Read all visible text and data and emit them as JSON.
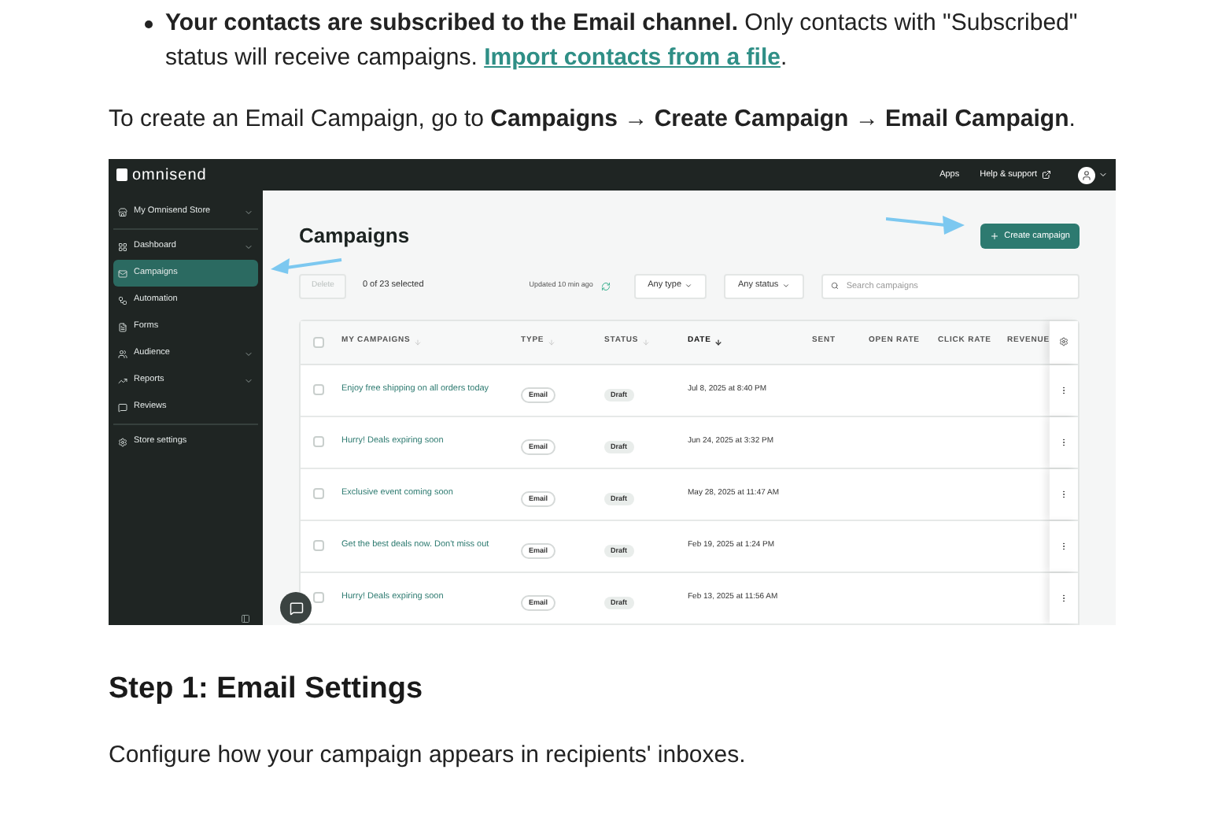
{
  "bullet": {
    "text": "**Your contacts are subscribed to the Email channel.** Only contacts with \"Subscribed\" status will receive campaigns.",
    "link": "Import contacts from a file",
    "after": "."
  },
  "intro": "To create an Email Campaign, go to **Campaigns → Create Campaign → Email Campaign**.",
  "screenshot": {
    "app_bar": {
      "logo": "omnisend",
      "links": [
        "Apps",
        "Help & support"
      ]
    },
    "sidebar": {
      "items": [
        {
          "label": "My Omnisend Store",
          "selected": false,
          "expandable": true
        },
        {
          "label": "Dashboard",
          "selected": false,
          "expandable": true
        },
        {
          "label": "Campaigns",
          "selected": true,
          "expandable": false
        },
        {
          "label": "Automation",
          "selected": false,
          "expandable": false
        },
        {
          "label": "Forms",
          "selected": false,
          "expandable": false
        },
        {
          "label": "Audience",
          "selected": false,
          "expandable": true
        },
        {
          "label": "Reports",
          "selected": false,
          "expandable": true
        },
        {
          "label": "Reviews",
          "selected": false,
          "expandable": false
        },
        {
          "label": "Store settings",
          "selected": false,
          "expandable": false
        }
      ]
    },
    "title": "Campaigns",
    "create_button": "Create campaign",
    "toolbar": {
      "delete_button": "Delete",
      "selection": "0 of 23 selected",
      "updated": "Updated 10 min ago",
      "type_filter": "Any type",
      "status_filter": "Any status",
      "search": {
        "placeholder": "Search campaigns"
      }
    },
    "table": {
      "select_all": {
        "checked": false
      },
      "columns": [
        {
          "label": "MY CAMPAIGNS",
          "sortable": true,
          "sorted": false
        },
        {
          "label": "TYPE",
          "sortable": true,
          "sorted": false
        },
        {
          "label": "STATUS",
          "sortable": true,
          "sorted": false
        },
        {
          "label": "DATE",
          "sortable": true,
          "sorted": true
        },
        {
          "label": "SENT",
          "sortable": false
        },
        {
          "label": "OPEN RATE",
          "sortable": false
        },
        {
          "label": "CLICK RATE",
          "sortable": false
        },
        {
          "label": "REVENUE",
          "sortable": false
        }
      ],
      "rows": [
        {
          "checked": false,
          "name": "Enjoy free shipping on all orders today",
          "type": "Email",
          "status": "Draft",
          "date": "Jul 8, 2025 at 8:40 PM"
        },
        {
          "checked": false,
          "name": "Hurry! Deals expiring soon",
          "type": "Email",
          "status": "Draft",
          "date": "Jun 24, 2025 at 3:32 PM"
        },
        {
          "checked": false,
          "name": "Exclusive event coming soon",
          "type": "Email",
          "status": "Draft",
          "date": "May 28, 2025 at 11:47 AM"
        },
        {
          "checked": false,
          "name": "Get the best deals now. Don't miss out",
          "type": "Email",
          "status": "Draft",
          "date": "Feb 19, 2025 at 1:24 PM"
        },
        {
          "checked": false,
          "name": "Hurry! Deals expiring soon",
          "type": "Email",
          "status": "Draft",
          "date": "Feb 13, 2025 at 11:56 AM"
        }
      ]
    }
  },
  "heading": "Step 1: Email Settings",
  "body": "Configure how your campaign appears in recipients' inboxes."
}
